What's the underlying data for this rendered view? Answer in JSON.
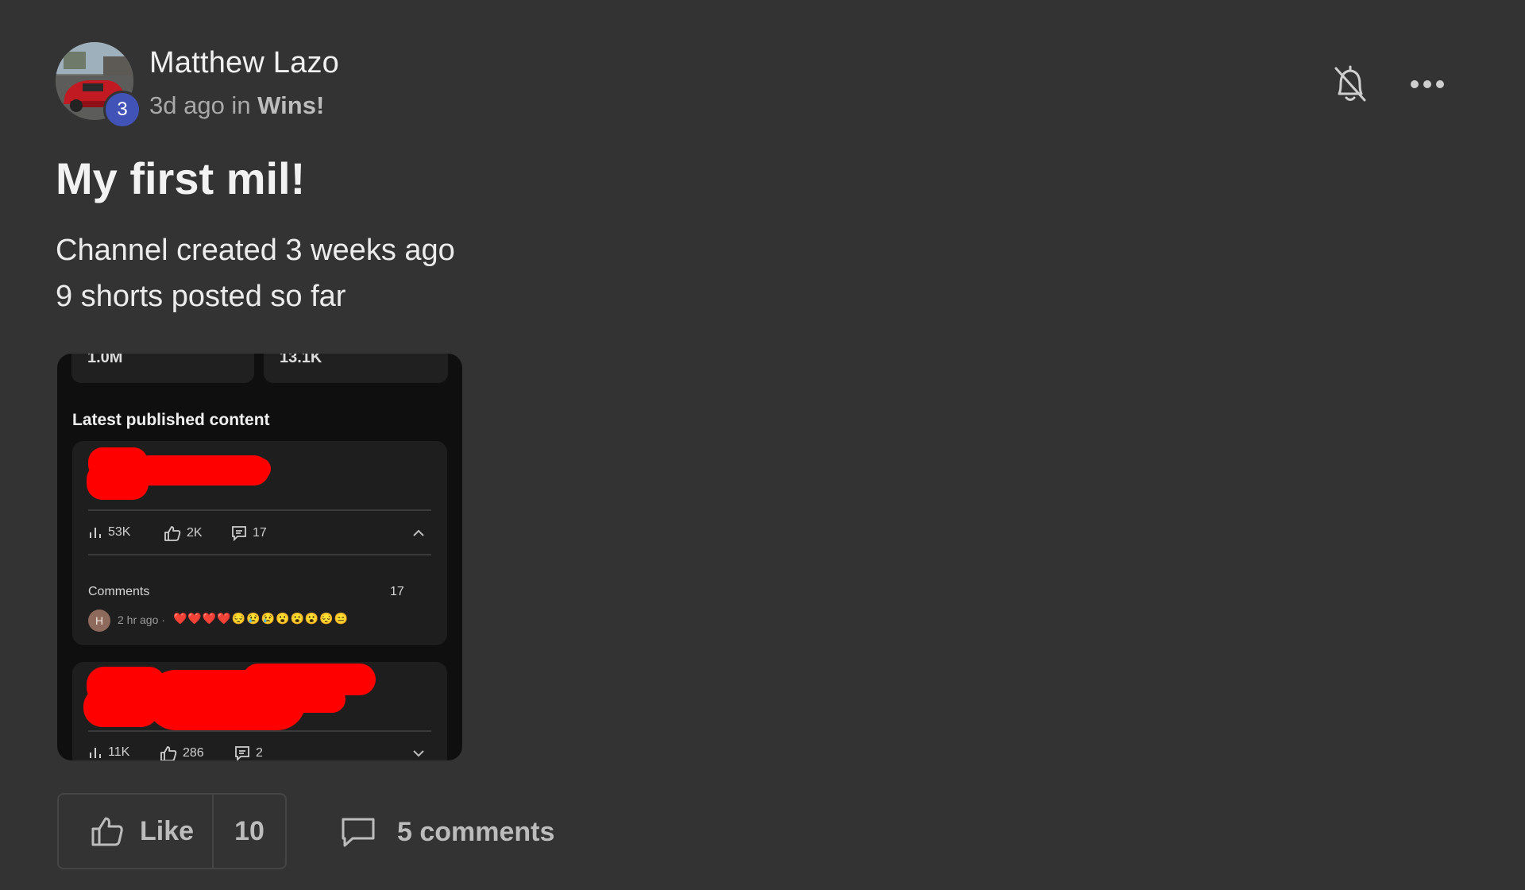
{
  "post": {
    "author": "Matthew Lazo",
    "level": "3",
    "time_ago": "3d ago in ",
    "category": "Wins!",
    "title": "My first mil!",
    "body_lines": [
      "Channel created 3 weeks ago",
      "9 shorts posted so far"
    ]
  },
  "header_icons": [
    "bell-off-icon",
    "more-options-icon"
  ],
  "embedded_screenshot": {
    "stat_values": [
      "1.0M",
      "13.1K"
    ],
    "section_title": "Latest published content",
    "items": [
      {
        "views": "53K",
        "likes": "2K",
        "comments": "17",
        "expanded": true
      },
      {
        "views": "11K",
        "likes": "286",
        "comments": "2",
        "expanded": false
      }
    ],
    "comments_label": "Comments",
    "comments_count": "17",
    "comment": {
      "avatar_letter": "H",
      "time": "2 hr ago ·",
      "emojis": "❤️❤️❤️❤️😔😢😢😮😮😮😔😑"
    }
  },
  "actions": {
    "like_label": "Like",
    "like_count": "10",
    "comments_label": "5 comments"
  },
  "colors": {
    "background": "#333333",
    "badge": "#4253b8",
    "redaction": "#ff0000"
  }
}
